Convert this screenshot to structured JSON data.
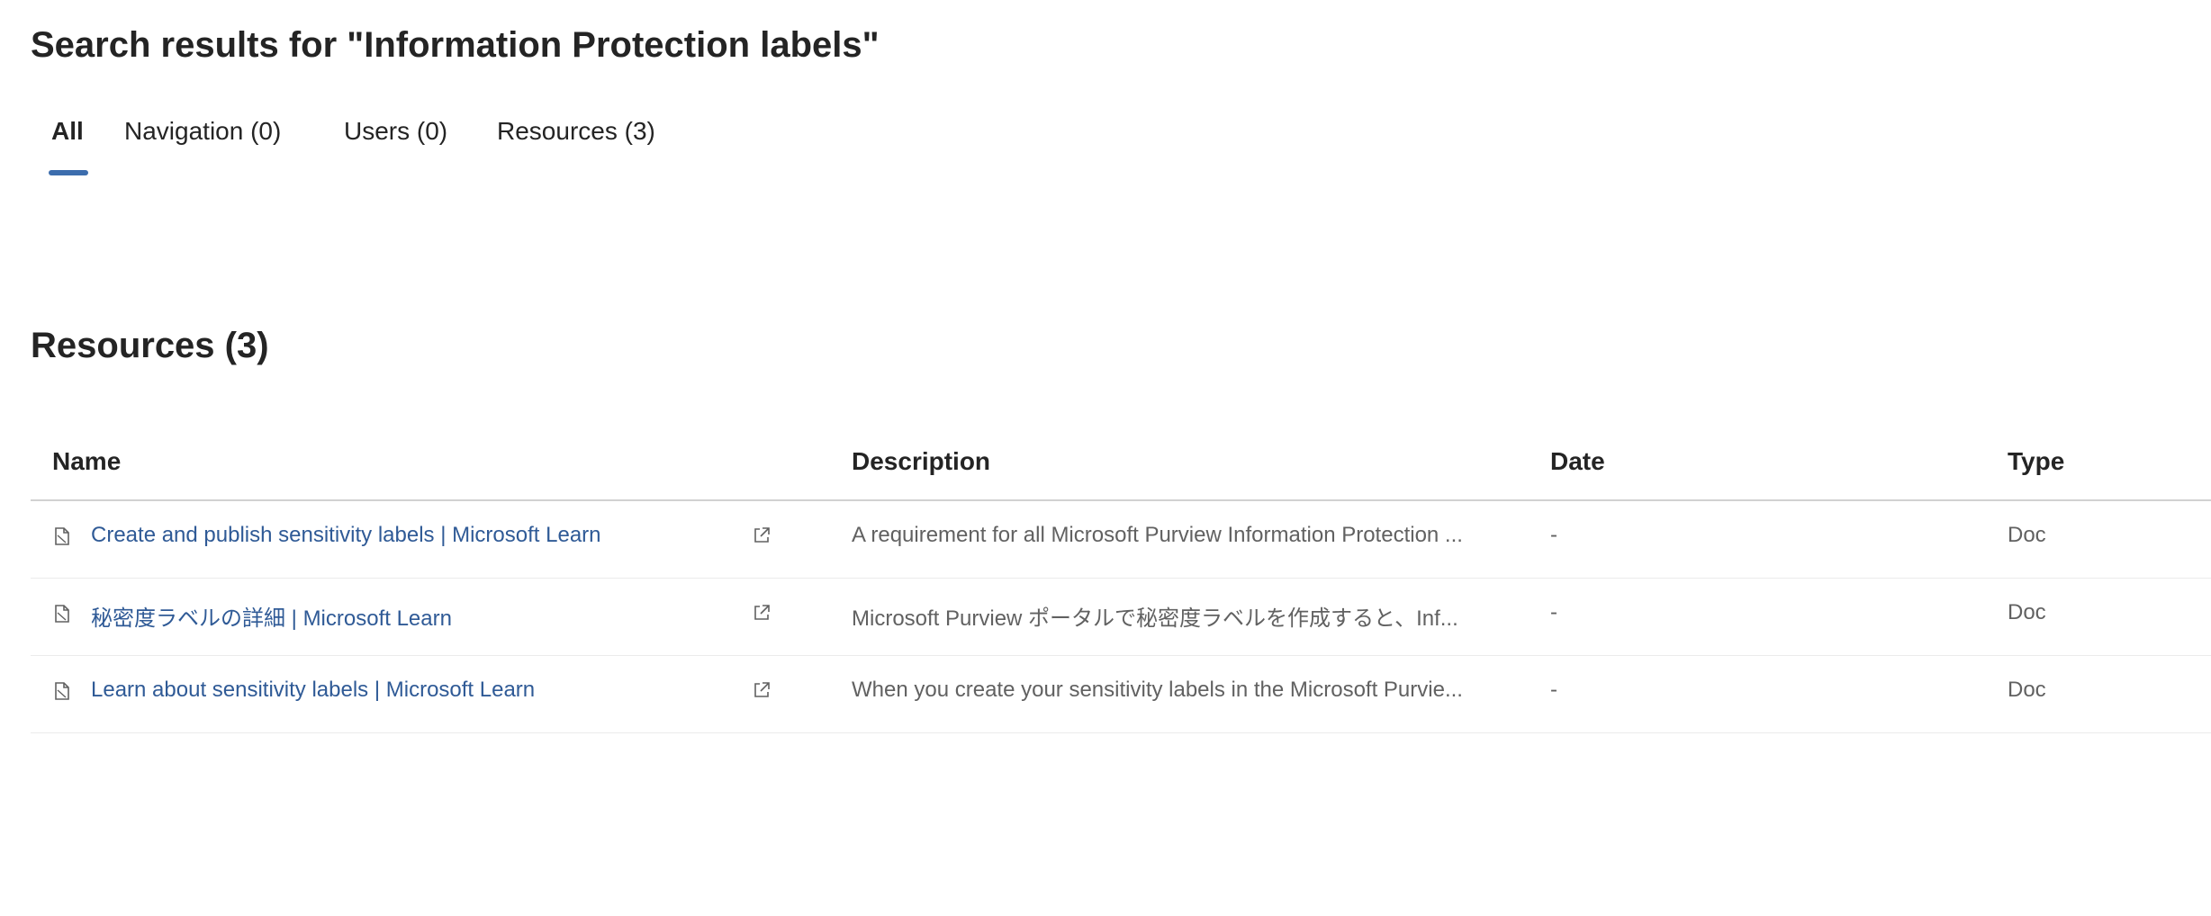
{
  "page": {
    "title": "Search results for \"Information Protection labels\""
  },
  "tabs": [
    {
      "label": "All",
      "active": true
    },
    {
      "label": "Navigation (0)",
      "active": false
    },
    {
      "label": "Users (0)",
      "active": false
    },
    {
      "label": "Resources (3)",
      "active": false
    }
  ],
  "resources": {
    "title": "Resources (3)",
    "columns": {
      "name": "Name",
      "description": "Description",
      "date": "Date",
      "type": "Type"
    },
    "rows": [
      {
        "icon": "document-icon",
        "name": "Create and publish sensitivity labels | Microsoft Learn",
        "description": "A requirement for all Microsoft Purview Information Protection ...",
        "date": "-",
        "type": "Doc"
      },
      {
        "icon": "document-icon",
        "name": "秘密度ラベルの詳細 | Microsoft Learn",
        "description": "Microsoft Purview ポータルで秘密度ラベルを作成すると、Inf...",
        "date": "-",
        "type": "Doc"
      },
      {
        "icon": "document-icon",
        "name": "Learn about sensitivity labels | Microsoft Learn",
        "description": "When you create your sensitivity labels in the Microsoft Purvie...",
        "date": "-",
        "type": "Doc"
      }
    ]
  },
  "colors": {
    "accent": "#3c6dad",
    "link": "#2f5a96",
    "text": "#242424",
    "muted": "#616161"
  }
}
